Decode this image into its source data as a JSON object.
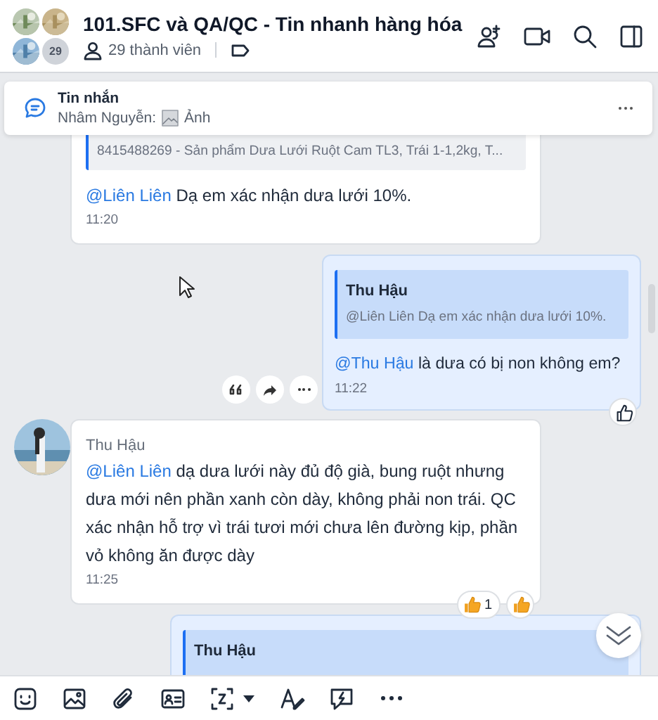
{
  "header": {
    "title": "101.SFC và QA/QC - Tin nhanh hàng hóa",
    "avatar_count": "29",
    "member_count": "29 thành viên"
  },
  "pinned": {
    "title": "Tin nhắn",
    "sender": "Nhâm Nguyễn:",
    "attachment": "Ảnh"
  },
  "messages": [
    {
      "outgoing": false,
      "avatar": false,
      "quote": {
        "text": "8415488269 - Sản phẩm Dưa Lưới Ruột Cam TL3, Trái 1-1,2kg, T..."
      },
      "mention": "@Liên Liên",
      "text": "Dạ em xác nhận dưa lưới 10%.",
      "time": "11:20",
      "actions": false,
      "like_button": false
    },
    {
      "outgoing": true,
      "avatar": false,
      "quote": {
        "author": "Thu Hậu",
        "text": "@Liên Liên Dạ em xác nhận dưa lưới 10%."
      },
      "mention": "@Thu Hậu",
      "text": "là dưa có bị non không em?",
      "time": "11:22",
      "actions": true,
      "like_button": true
    },
    {
      "outgoing": false,
      "avatar": true,
      "sender": "Thu Hậu",
      "mention": "@Liên Liên",
      "text": "dạ dưa lưới này đủ độ già, bung ruột nhưng dưa mới nên phần xanh còn dày, không phải non trái. QC xác nhận hỗ trợ vì trái tươi mới chưa lên đường kịp, phần vỏ không ăn được dày",
      "time": "11:25",
      "actions": false,
      "like_button": true,
      "reactions": [
        {
          "count": "1"
        }
      ]
    },
    {
      "outgoing": true,
      "avatar": false,
      "partial": true,
      "quote": {
        "author": "Thu Hậu"
      },
      "actions": false,
      "like_button": false
    }
  ]
}
